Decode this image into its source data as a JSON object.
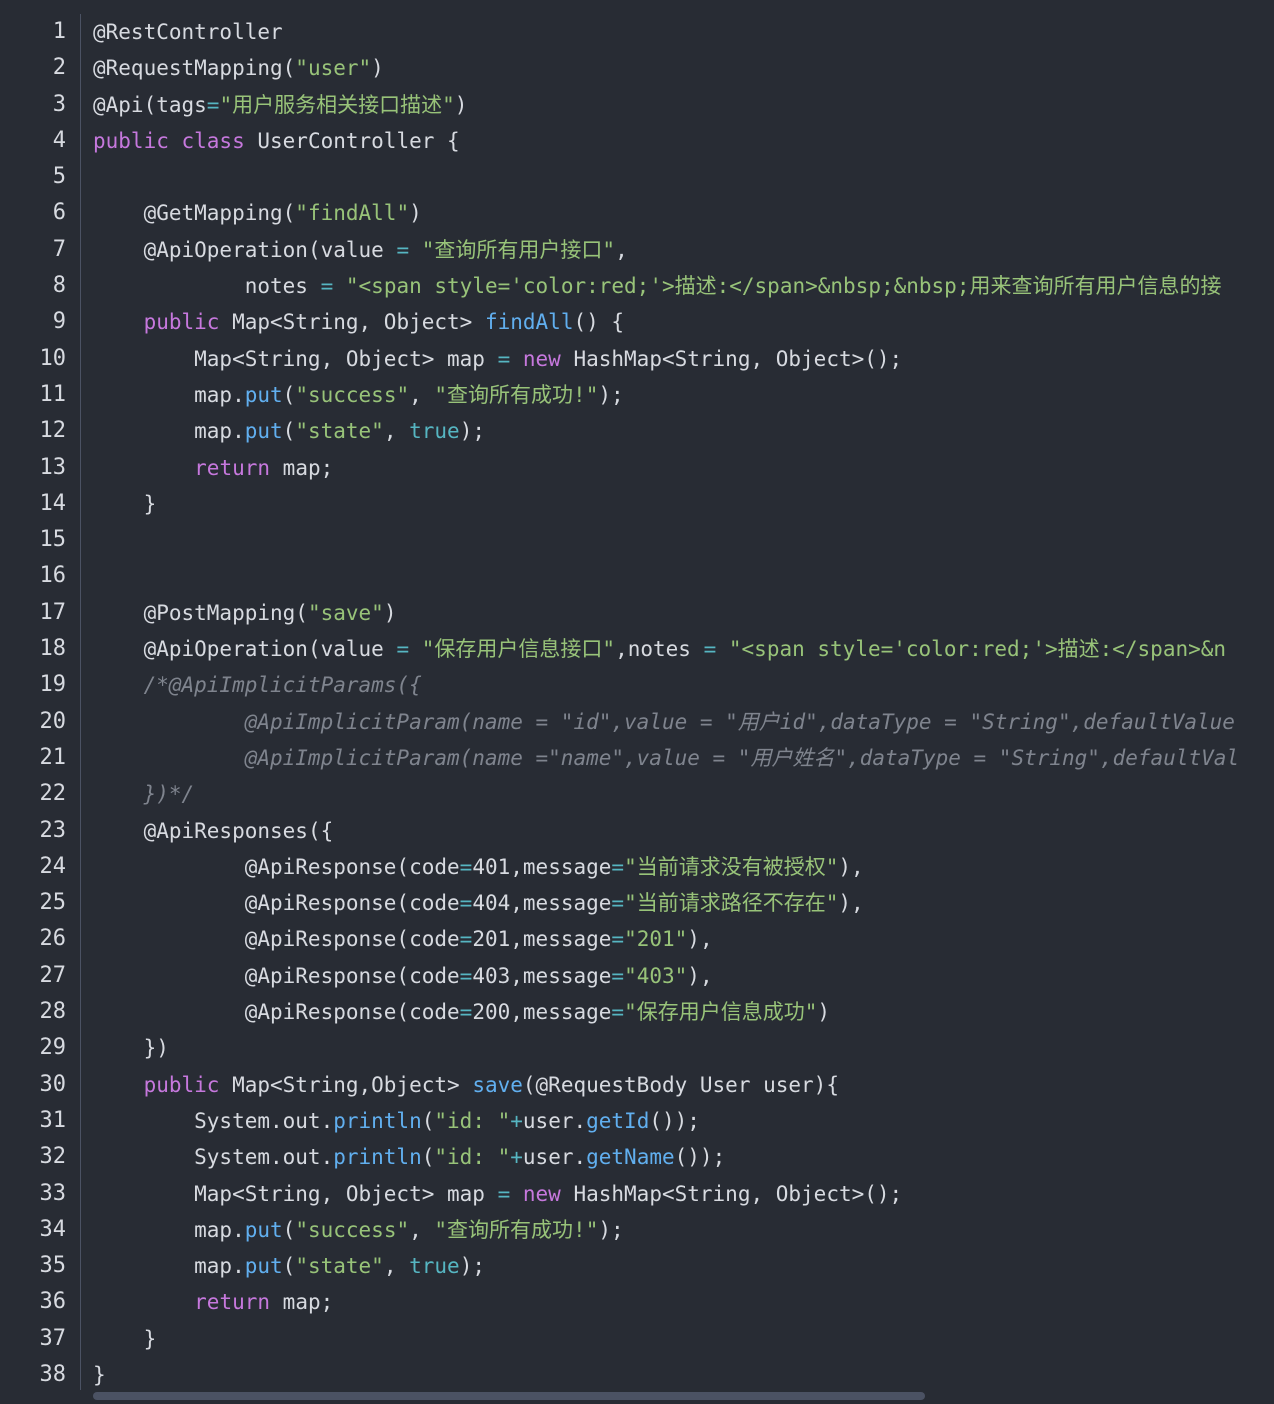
{
  "editor": {
    "line_numbers": [
      "1",
      "2",
      "3",
      "4",
      "5",
      "6",
      "7",
      "8",
      "9",
      "10",
      "11",
      "12",
      "13",
      "14",
      "15",
      "16",
      "17",
      "18",
      "19",
      "20",
      "21",
      "22",
      "23",
      "24",
      "25",
      "26",
      "27",
      "28",
      "29",
      "30",
      "31",
      "32",
      "33",
      "34",
      "35",
      "36",
      "37",
      "38"
    ],
    "lines": [
      [
        {
          "t": "ann",
          "v": "@RestController"
        }
      ],
      [
        {
          "t": "ann",
          "v": "@RequestMapping("
        },
        {
          "t": "str",
          "v": "\"user\""
        },
        {
          "t": "txt",
          "v": ")"
        }
      ],
      [
        {
          "t": "ann",
          "v": "@Api("
        },
        {
          "t": "txt",
          "v": "tags"
        },
        {
          "t": "op",
          "v": "="
        },
        {
          "t": "str",
          "v": "\"用户服务相关接口描述\""
        },
        {
          "t": "txt",
          "v": ")"
        }
      ],
      [
        {
          "t": "kw",
          "v": "public class "
        },
        {
          "t": "txt",
          "v": "UserController {"
        }
      ],
      [],
      [
        {
          "t": "txt",
          "v": "    "
        },
        {
          "t": "ann",
          "v": "@GetMapping("
        },
        {
          "t": "str",
          "v": "\"findAll\""
        },
        {
          "t": "txt",
          "v": ")"
        }
      ],
      [
        {
          "t": "txt",
          "v": "    "
        },
        {
          "t": "ann",
          "v": "@ApiOperation("
        },
        {
          "t": "txt",
          "v": "value "
        },
        {
          "t": "op",
          "v": "="
        },
        {
          "t": "txt",
          "v": " "
        },
        {
          "t": "str",
          "v": "\"查询所有用户接口\""
        },
        {
          "t": "txt",
          "v": ","
        }
      ],
      [
        {
          "t": "txt",
          "v": "            notes "
        },
        {
          "t": "op",
          "v": "="
        },
        {
          "t": "txt",
          "v": " "
        },
        {
          "t": "str",
          "v": "\"<span style='color:red;'>描述:</span>&nbsp;&nbsp;用来查询所有用户信息的接"
        }
      ],
      [
        {
          "t": "txt",
          "v": "    "
        },
        {
          "t": "kw",
          "v": "public "
        },
        {
          "t": "txt",
          "v": "Map<String, Object> "
        },
        {
          "t": "fn",
          "v": "findAll"
        },
        {
          "t": "txt",
          "v": "() {"
        }
      ],
      [
        {
          "t": "txt",
          "v": "        Map<String, Object> map "
        },
        {
          "t": "op",
          "v": "="
        },
        {
          "t": "txt",
          "v": " "
        },
        {
          "t": "kw",
          "v": "new "
        },
        {
          "t": "txt",
          "v": "HashMap<String, Object>();"
        }
      ],
      [
        {
          "t": "txt",
          "v": "        map."
        },
        {
          "t": "fn",
          "v": "put"
        },
        {
          "t": "txt",
          "v": "("
        },
        {
          "t": "str",
          "v": "\"success\""
        },
        {
          "t": "txt",
          "v": ", "
        },
        {
          "t": "str",
          "v": "\"查询所有成功!\""
        },
        {
          "t": "txt",
          "v": ");"
        }
      ],
      [
        {
          "t": "txt",
          "v": "        map."
        },
        {
          "t": "fn",
          "v": "put"
        },
        {
          "t": "txt",
          "v": "("
        },
        {
          "t": "str",
          "v": "\"state\""
        },
        {
          "t": "txt",
          "v": ", "
        },
        {
          "t": "bool",
          "v": "true"
        },
        {
          "t": "txt",
          "v": ");"
        }
      ],
      [
        {
          "t": "txt",
          "v": "        "
        },
        {
          "t": "kw",
          "v": "return "
        },
        {
          "t": "txt",
          "v": "map;"
        }
      ],
      [
        {
          "t": "txt",
          "v": "    }"
        }
      ],
      [],
      [],
      [
        {
          "t": "txt",
          "v": "    "
        },
        {
          "t": "ann",
          "v": "@PostMapping("
        },
        {
          "t": "str",
          "v": "\"save\""
        },
        {
          "t": "txt",
          "v": ")"
        }
      ],
      [
        {
          "t": "txt",
          "v": "    "
        },
        {
          "t": "ann",
          "v": "@ApiOperation("
        },
        {
          "t": "txt",
          "v": "value "
        },
        {
          "t": "op",
          "v": "="
        },
        {
          "t": "txt",
          "v": " "
        },
        {
          "t": "str",
          "v": "\"保存用户信息接口\""
        },
        {
          "t": "txt",
          "v": ",notes "
        },
        {
          "t": "op",
          "v": "="
        },
        {
          "t": "txt",
          "v": " "
        },
        {
          "t": "str",
          "v": "\"<span style='color:red;'>描述:</span>&n"
        }
      ],
      [
        {
          "t": "txt",
          "v": "    "
        },
        {
          "t": "cmt",
          "v": "/*@ApiImplicitParams({"
        }
      ],
      [
        {
          "t": "txt",
          "v": "            "
        },
        {
          "t": "cmt",
          "v": "@ApiImplicitParam(name = \"id\",value = \"用户id\",dataType = \"String\",defaultValue"
        }
      ],
      [
        {
          "t": "txt",
          "v": "            "
        },
        {
          "t": "cmt",
          "v": "@ApiImplicitParam(name =\"name\",value = \"用户姓名\",dataType = \"String\",defaultVal"
        }
      ],
      [
        {
          "t": "txt",
          "v": "    "
        },
        {
          "t": "cmt",
          "v": "})*/"
        }
      ],
      [
        {
          "t": "txt",
          "v": "    "
        },
        {
          "t": "ann",
          "v": "@ApiResponses("
        },
        {
          "t": "txt",
          "v": "{"
        }
      ],
      [
        {
          "t": "txt",
          "v": "            "
        },
        {
          "t": "ann",
          "v": "@ApiResponse("
        },
        {
          "t": "txt",
          "v": "code"
        },
        {
          "t": "op",
          "v": "="
        },
        {
          "t": "num",
          "v": "401"
        },
        {
          "t": "txt",
          "v": ",message"
        },
        {
          "t": "op",
          "v": "="
        },
        {
          "t": "str",
          "v": "\"当前请求没有被授权\""
        },
        {
          "t": "txt",
          "v": "),"
        }
      ],
      [
        {
          "t": "txt",
          "v": "            "
        },
        {
          "t": "ann",
          "v": "@ApiResponse("
        },
        {
          "t": "txt",
          "v": "code"
        },
        {
          "t": "op",
          "v": "="
        },
        {
          "t": "num",
          "v": "404"
        },
        {
          "t": "txt",
          "v": ",message"
        },
        {
          "t": "op",
          "v": "="
        },
        {
          "t": "str",
          "v": "\"当前请求路径不存在\""
        },
        {
          "t": "txt",
          "v": "),"
        }
      ],
      [
        {
          "t": "txt",
          "v": "            "
        },
        {
          "t": "ann",
          "v": "@ApiResponse("
        },
        {
          "t": "txt",
          "v": "code"
        },
        {
          "t": "op",
          "v": "="
        },
        {
          "t": "num",
          "v": "201"
        },
        {
          "t": "txt",
          "v": ",message"
        },
        {
          "t": "op",
          "v": "="
        },
        {
          "t": "str",
          "v": "\"201\""
        },
        {
          "t": "txt",
          "v": "),"
        }
      ],
      [
        {
          "t": "txt",
          "v": "            "
        },
        {
          "t": "ann",
          "v": "@ApiResponse("
        },
        {
          "t": "txt",
          "v": "code"
        },
        {
          "t": "op",
          "v": "="
        },
        {
          "t": "num",
          "v": "403"
        },
        {
          "t": "txt",
          "v": ",message"
        },
        {
          "t": "op",
          "v": "="
        },
        {
          "t": "str",
          "v": "\"403\""
        },
        {
          "t": "txt",
          "v": "),"
        }
      ],
      [
        {
          "t": "txt",
          "v": "            "
        },
        {
          "t": "ann",
          "v": "@ApiResponse("
        },
        {
          "t": "txt",
          "v": "code"
        },
        {
          "t": "op",
          "v": "="
        },
        {
          "t": "num",
          "v": "200"
        },
        {
          "t": "txt",
          "v": ",message"
        },
        {
          "t": "op",
          "v": "="
        },
        {
          "t": "str",
          "v": "\"保存用户信息成功\""
        },
        {
          "t": "txt",
          "v": ")"
        }
      ],
      [
        {
          "t": "txt",
          "v": "    })"
        }
      ],
      [
        {
          "t": "txt",
          "v": "    "
        },
        {
          "t": "kw",
          "v": "public "
        },
        {
          "t": "txt",
          "v": "Map<String,Object> "
        },
        {
          "t": "fn",
          "v": "save"
        },
        {
          "t": "txt",
          "v": "(@RequestBody User user){"
        }
      ],
      [
        {
          "t": "txt",
          "v": "        System.out."
        },
        {
          "t": "fn",
          "v": "println"
        },
        {
          "t": "txt",
          "v": "("
        },
        {
          "t": "str",
          "v": "\"id: \""
        },
        {
          "t": "op",
          "v": "+"
        },
        {
          "t": "txt",
          "v": "user."
        },
        {
          "t": "fn",
          "v": "getId"
        },
        {
          "t": "txt",
          "v": "());"
        }
      ],
      [
        {
          "t": "txt",
          "v": "        System.out."
        },
        {
          "t": "fn",
          "v": "println"
        },
        {
          "t": "txt",
          "v": "("
        },
        {
          "t": "str",
          "v": "\"id: \""
        },
        {
          "t": "op",
          "v": "+"
        },
        {
          "t": "txt",
          "v": "user."
        },
        {
          "t": "fn",
          "v": "getName"
        },
        {
          "t": "txt",
          "v": "());"
        }
      ],
      [
        {
          "t": "txt",
          "v": "        Map<String, Object> map "
        },
        {
          "t": "op",
          "v": "="
        },
        {
          "t": "txt",
          "v": " "
        },
        {
          "t": "kw",
          "v": "new "
        },
        {
          "t": "txt",
          "v": "HashMap<String, Object>();"
        }
      ],
      [
        {
          "t": "txt",
          "v": "        map."
        },
        {
          "t": "fn",
          "v": "put"
        },
        {
          "t": "txt",
          "v": "("
        },
        {
          "t": "str",
          "v": "\"success\""
        },
        {
          "t": "txt",
          "v": ", "
        },
        {
          "t": "str",
          "v": "\"查询所有成功!\""
        },
        {
          "t": "txt",
          "v": ");"
        }
      ],
      [
        {
          "t": "txt",
          "v": "        map."
        },
        {
          "t": "fn",
          "v": "put"
        },
        {
          "t": "txt",
          "v": "("
        },
        {
          "t": "str",
          "v": "\"state\""
        },
        {
          "t": "txt",
          "v": ", "
        },
        {
          "t": "bool",
          "v": "true"
        },
        {
          "t": "txt",
          "v": ");"
        }
      ],
      [
        {
          "t": "txt",
          "v": "        "
        },
        {
          "t": "kw",
          "v": "return "
        },
        {
          "t": "txt",
          "v": "map;"
        }
      ],
      [
        {
          "t": "txt",
          "v": "    }"
        }
      ],
      [
        {
          "t": "txt",
          "v": "}"
        }
      ]
    ]
  },
  "colors": {
    "background": "#282c34",
    "keyword": "#c678dd",
    "string": "#98c379",
    "function": "#61afef",
    "comment": "#7f848e",
    "text": "#d7dae0"
  }
}
